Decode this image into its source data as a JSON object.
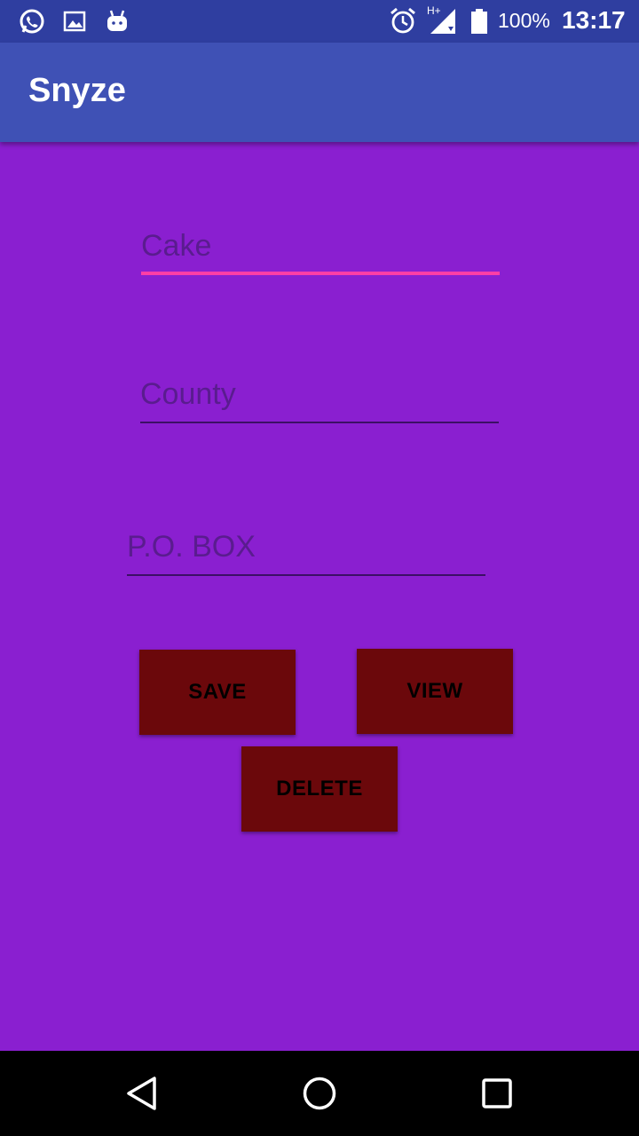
{
  "status_bar": {
    "icons_left": [
      "whatsapp-icon",
      "image-icon",
      "android-icon"
    ],
    "network": "H+",
    "battery": "100%",
    "time": "13:17"
  },
  "app_bar": {
    "title": "Snyze"
  },
  "form": {
    "field1": {
      "placeholder": "Cake",
      "value": ""
    },
    "field2": {
      "placeholder": "County",
      "value": ""
    },
    "field3": {
      "placeholder": "P.O. BOX",
      "value": ""
    }
  },
  "buttons": {
    "save": "SAVE",
    "view": "VIEW",
    "delete": "DELETE"
  },
  "colors": {
    "background": "#8a1fd0",
    "app_bar": "#3f51b5",
    "status_bar": "#2f3ea0",
    "button": "#6b080b",
    "focus_underline": "#ff3ea6"
  },
  "nav_bar": {
    "icons": [
      "back-icon",
      "home-icon",
      "recents-icon"
    ]
  }
}
